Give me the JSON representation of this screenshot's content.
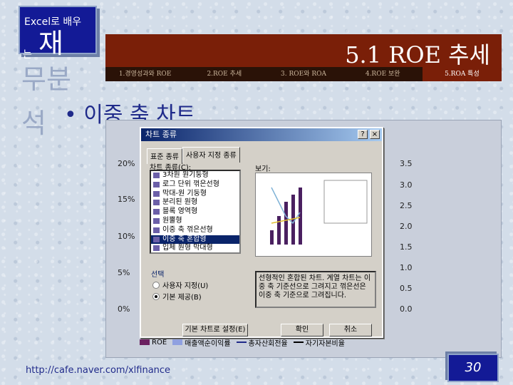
{
  "tag": {
    "line1": "Excel로 배우",
    "line2": "는",
    "big": "재"
  },
  "side_chars": [
    "무분",
    "석"
  ],
  "title": "5.1 ROE 추세",
  "nav": [
    "1.경영성과와 ROE",
    "2.ROE 추세",
    "3. ROE와 ROA",
    "4.ROE 보완",
    "5.ROA 특성"
  ],
  "bullet": "• 이중 축 차트",
  "y_left": [
    "20%",
    "15%",
    "10%",
    "5%",
    "0%"
  ],
  "y_right": [
    "3.5",
    "3.0",
    "2.5",
    "2.0",
    "1.5",
    "1.0",
    "0.5",
    "0.0"
  ],
  "dialog": {
    "title": "차트 종류",
    "help": "?",
    "close": "×",
    "tabs": [
      "표준 종류",
      "사용자 지정 종류"
    ],
    "list_label": "차트 종류(C):",
    "items": [
      "3차원 원기둥형",
      "로그 단위 꺾은선형",
      "막대-원 기둥형",
      "분리된 원형",
      "블록 영역형",
      "원뿔형",
      "이중 축 꺾은선형",
      "이중 축 혼합형",
      "입체 원형 막대형"
    ],
    "selected_index": 7,
    "preview_label": "보기:",
    "options_label": "선택",
    "radio1": "사용자 지정(U)",
    "radio2": "기본 제공(B)",
    "description": "선형적인 혼합된 차트. 계열 차트는 이중 축 기준선으로 그려지고 꺾은선은 이중 축 기준으로 그려집니다.",
    "default_btn": "기본 차트로 설정(E)",
    "ok": "확인",
    "cancel": "취소"
  },
  "legend": [
    "ROE",
    "매출액순이익률",
    "총자산회전율",
    "자기자본비율"
  ],
  "url": "http://cafe.naver.com/xlfinance",
  "slide_number": "30"
}
